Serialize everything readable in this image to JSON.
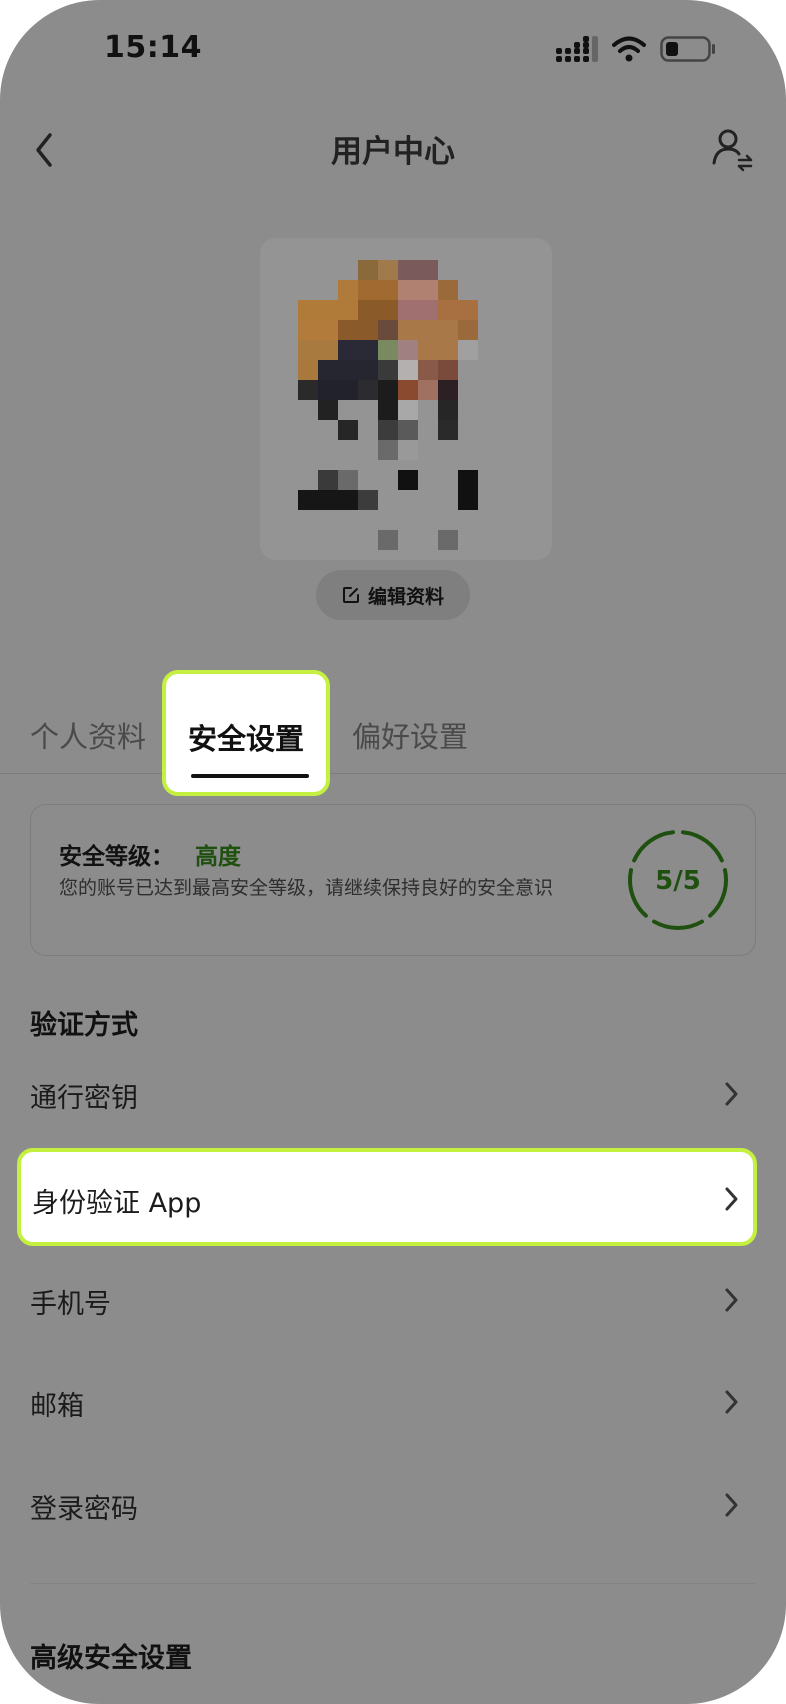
{
  "status_bar": {
    "time": "15:14",
    "icons": [
      "cellular-signal-icon",
      "wifi-icon",
      "battery-icon"
    ]
  },
  "nav": {
    "title": "用户中心",
    "back_icon": "chevron-left-icon",
    "user_switch_icon": "user-switch-icon"
  },
  "profile": {
    "edit_label": "编辑资料",
    "edit_icon": "edit-icon"
  },
  "tabs": [
    {
      "label": "个人资料",
      "active": false
    },
    {
      "label": "安全设置",
      "active": true
    },
    {
      "label": "偏好设置",
      "active": false
    }
  ],
  "security_card": {
    "level_title": "安全等级：",
    "level_value": "高度",
    "description": "您的账号已达到最高安全等级，请继续保持良好的安全意识",
    "score": "5/5",
    "score_value": 5,
    "score_max": 5,
    "ring_color": "#1f5010"
  },
  "verify_section": {
    "title": "验证方式",
    "items": [
      {
        "label": "通行密钥",
        "highlighted": false
      },
      {
        "label": "身份验证 App",
        "highlighted": true
      },
      {
        "label": "手机号",
        "highlighted": false
      },
      {
        "label": "邮箱",
        "highlighted": false
      },
      {
        "label": "登录密码",
        "highlighted": false
      }
    ]
  },
  "advanced_section": {
    "title": "高级安全设置"
  },
  "colors": {
    "highlight_border": "#c4f040",
    "overlay": "#8c8c8c",
    "level_green": "#1f5010"
  }
}
